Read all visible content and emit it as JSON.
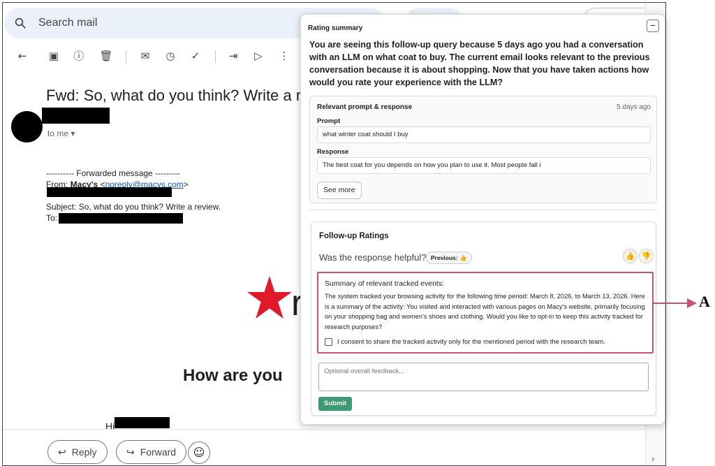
{
  "gmail": {
    "search_placeholder": "Search mail",
    "subject": "Fwd: So, what do you think? Write a review.",
    "to_me": "to me ▾",
    "forwarded": {
      "header_line": "---------- Forwarded message ---------",
      "from_label": "From: ",
      "from_name": "Macy's",
      "from_email": "noreply@macys.com",
      "subject_line": "Subject: So, what do you think? Write a review.",
      "to_label": "To:"
    },
    "body_heading": "How are you",
    "greeting": "Hi",
    "reply_label": "Reply",
    "forward_label": "Forward",
    "toolbar_icons": [
      "back-arrow-icon",
      "archive-icon",
      "report-spam-icon",
      "delete-icon",
      "mark-unread-icon",
      "snooze-icon",
      "add-task-icon",
      "move-to-icon",
      "label-icon",
      "more-icon"
    ]
  },
  "panel": {
    "title": "Rating summary",
    "collapse_label": "−",
    "intro": "You are seeing this follow-up query because 5 days ago you had a conversation with an LLM on what coat to buy. The current email looks relevant to the previous conversation because it is about shopping. Now that you have taken actions how would you rate your experience with the LLM?",
    "prompt_card": {
      "title": "Relevant prompt & response",
      "time": "5 days ago",
      "prompt_label": "Prompt",
      "prompt_value": "what winter coat should I buy",
      "response_label": "Response",
      "response_value": "The best coat for you depends on how you plan to use it. Most people fall i",
      "see_more": "See more"
    },
    "followup": {
      "title": "Follow-up Ratings",
      "question": "Was the response helpful?",
      "previous_badge": "Previous: 👍",
      "thumbs_up": "👍",
      "thumbs_down": "👎",
      "events_title": "Summary of relevant tracked events:",
      "events_body": "The system tracked your browsing activity for the following time period: March 8, 2026, to March 13, 2026. Here is a summary of the activity: You visited and interacted with various pages on Macy's website, primarily focusing on your shopping bag and women's shoes and clothing. Would you like to opt-in to keep this activity tracked for research purposes?",
      "consent_label": "I consent to share the tracked activity only for the mentioned period with the research team.",
      "consent_checked": false,
      "feedback_placeholder": "Optional overall feedback...",
      "submit_label": "Submit"
    }
  },
  "annotation": {
    "label": "A",
    "color": "#c7526e"
  },
  "colors": {
    "submit": "#3e9a72",
    "highlight_border": "#c7526e",
    "macys_star": "#e11a2b"
  }
}
